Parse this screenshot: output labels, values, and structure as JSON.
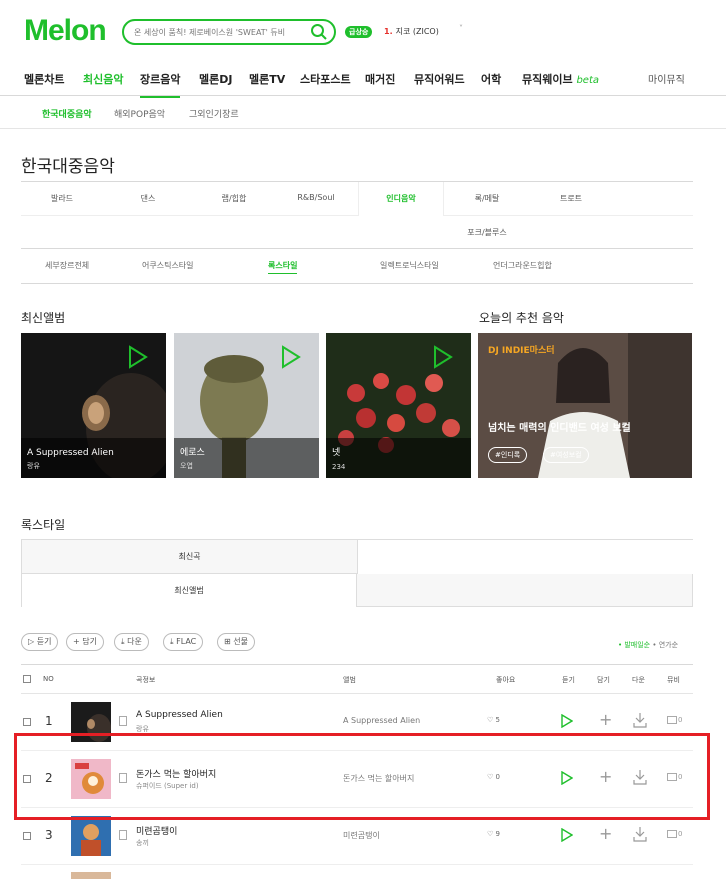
{
  "logo": "Melon",
  "search": {
    "placeholder": "온 세상이 품칙! 제로베이스원 'SWEAT' 듀비"
  },
  "realtime": {
    "badge": "급상승",
    "rank": "1.",
    "artist": "지코 (ZICO)",
    "caret": "˅"
  },
  "gnb": [
    "멜론차트",
    "최신음악",
    "장르음악",
    "멜론DJ",
    "멜론TV",
    "스타포스트",
    "매거진",
    "뮤직어워드",
    "어학",
    "뮤직웨이브",
    "마이뮤직"
  ],
  "gnb_beta": "beta",
  "subnav": [
    "한국대중음악",
    "해외POP음악",
    "그외인기장르"
  ],
  "page_title": "한국대중음악",
  "genres": [
    "발라드",
    "댄스",
    "랩/힙합",
    "R&B/Soul",
    "인디음악",
    "록/메탈",
    "트로트",
    "포크/블루스"
  ],
  "subgenres": [
    "세부장르전체",
    "어쿠스틱스타일",
    "록스타일",
    "일렉트로닉스타일",
    "언더그라운드힙합"
  ],
  "latest_albums_title": "최신앨범",
  "albums": [
    {
      "title": "A Suppressed Alien",
      "artist": "랑유"
    },
    {
      "title": "에로스",
      "artist": "오엽"
    },
    {
      "title": "넷",
      "artist": "234"
    }
  ],
  "recommend": {
    "section_title": "오늘의 추천 음악",
    "dj_prefix": "DJ",
    "dj": "INDIE마스터",
    "title": "넘치는 매력의 인디밴드 여성 보컬",
    "tags": [
      "#인디록",
      "#여성보컬"
    ]
  },
  "style_section": {
    "title": "록스타일",
    "tabs": [
      "최신곡",
      "최신앨범"
    ]
  },
  "actions": [
    "듣기",
    "담기",
    "다운",
    "FLAC",
    "선물"
  ],
  "sort": {
    "active": "• 발매일순",
    "other": "• 연가순"
  },
  "columns": [
    "NO",
    "곡정보",
    "앨범",
    "좋아요",
    "듣기",
    "담기",
    "다운",
    "뮤비"
  ],
  "songs": [
    {
      "no": "1",
      "title": "A Suppressed Alien",
      "artist": "랑유",
      "album": "A Suppressed Alien",
      "likes": "5",
      "mv": "0"
    },
    {
      "no": "2",
      "title": "돈가스 먹는 할아버지",
      "artist": "슈퍼이드 (Super id)",
      "album": "돈가스 먹는 할아버지",
      "likes": "0",
      "mv": "0"
    },
    {
      "no": "3",
      "title": "미련곰탱이",
      "artist": "송끼",
      "album": "미련곰탱이",
      "likes": "9",
      "mv": "0"
    }
  ],
  "colors": {
    "brand": "#1fbf2c",
    "highlight": "#e51f25"
  }
}
